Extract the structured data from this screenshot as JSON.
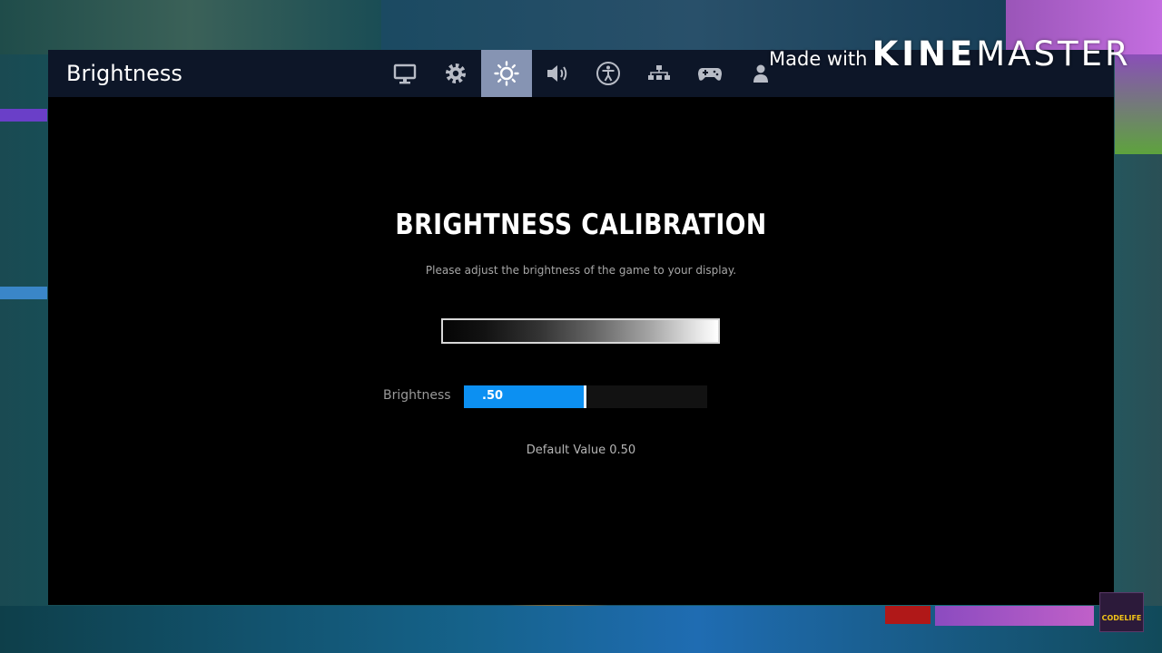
{
  "window": {
    "title": "Brightness"
  },
  "tabs": [
    {
      "icon": "monitor-icon",
      "active": false
    },
    {
      "icon": "gear-icon",
      "active": false
    },
    {
      "icon": "brightness-icon",
      "active": true
    },
    {
      "icon": "speaker-icon",
      "active": false
    },
    {
      "icon": "accessibility-icon",
      "active": false
    },
    {
      "icon": "network-icon",
      "active": false
    },
    {
      "icon": "gamepad-icon",
      "active": false
    },
    {
      "icon": "account-icon",
      "active": false
    }
  ],
  "calibration": {
    "heading": "BRIGHTNESS CALIBRATION",
    "subtitle": "Please adjust the brightness of the game to your display.",
    "slider_label": "Brightness",
    "slider_value_text": ".50",
    "slider_value": 0.5,
    "default_value_text": "Default Value 0.50"
  },
  "watermark": {
    "prefix": "Made with",
    "brand_bold": "KINE",
    "brand_light": "MASTER"
  },
  "channel_logo": {
    "text": "CODELIFE"
  },
  "colors": {
    "accent_blue": "#0c90f2",
    "active_tab": "#8694b3",
    "titlebar": "#0d1628"
  }
}
